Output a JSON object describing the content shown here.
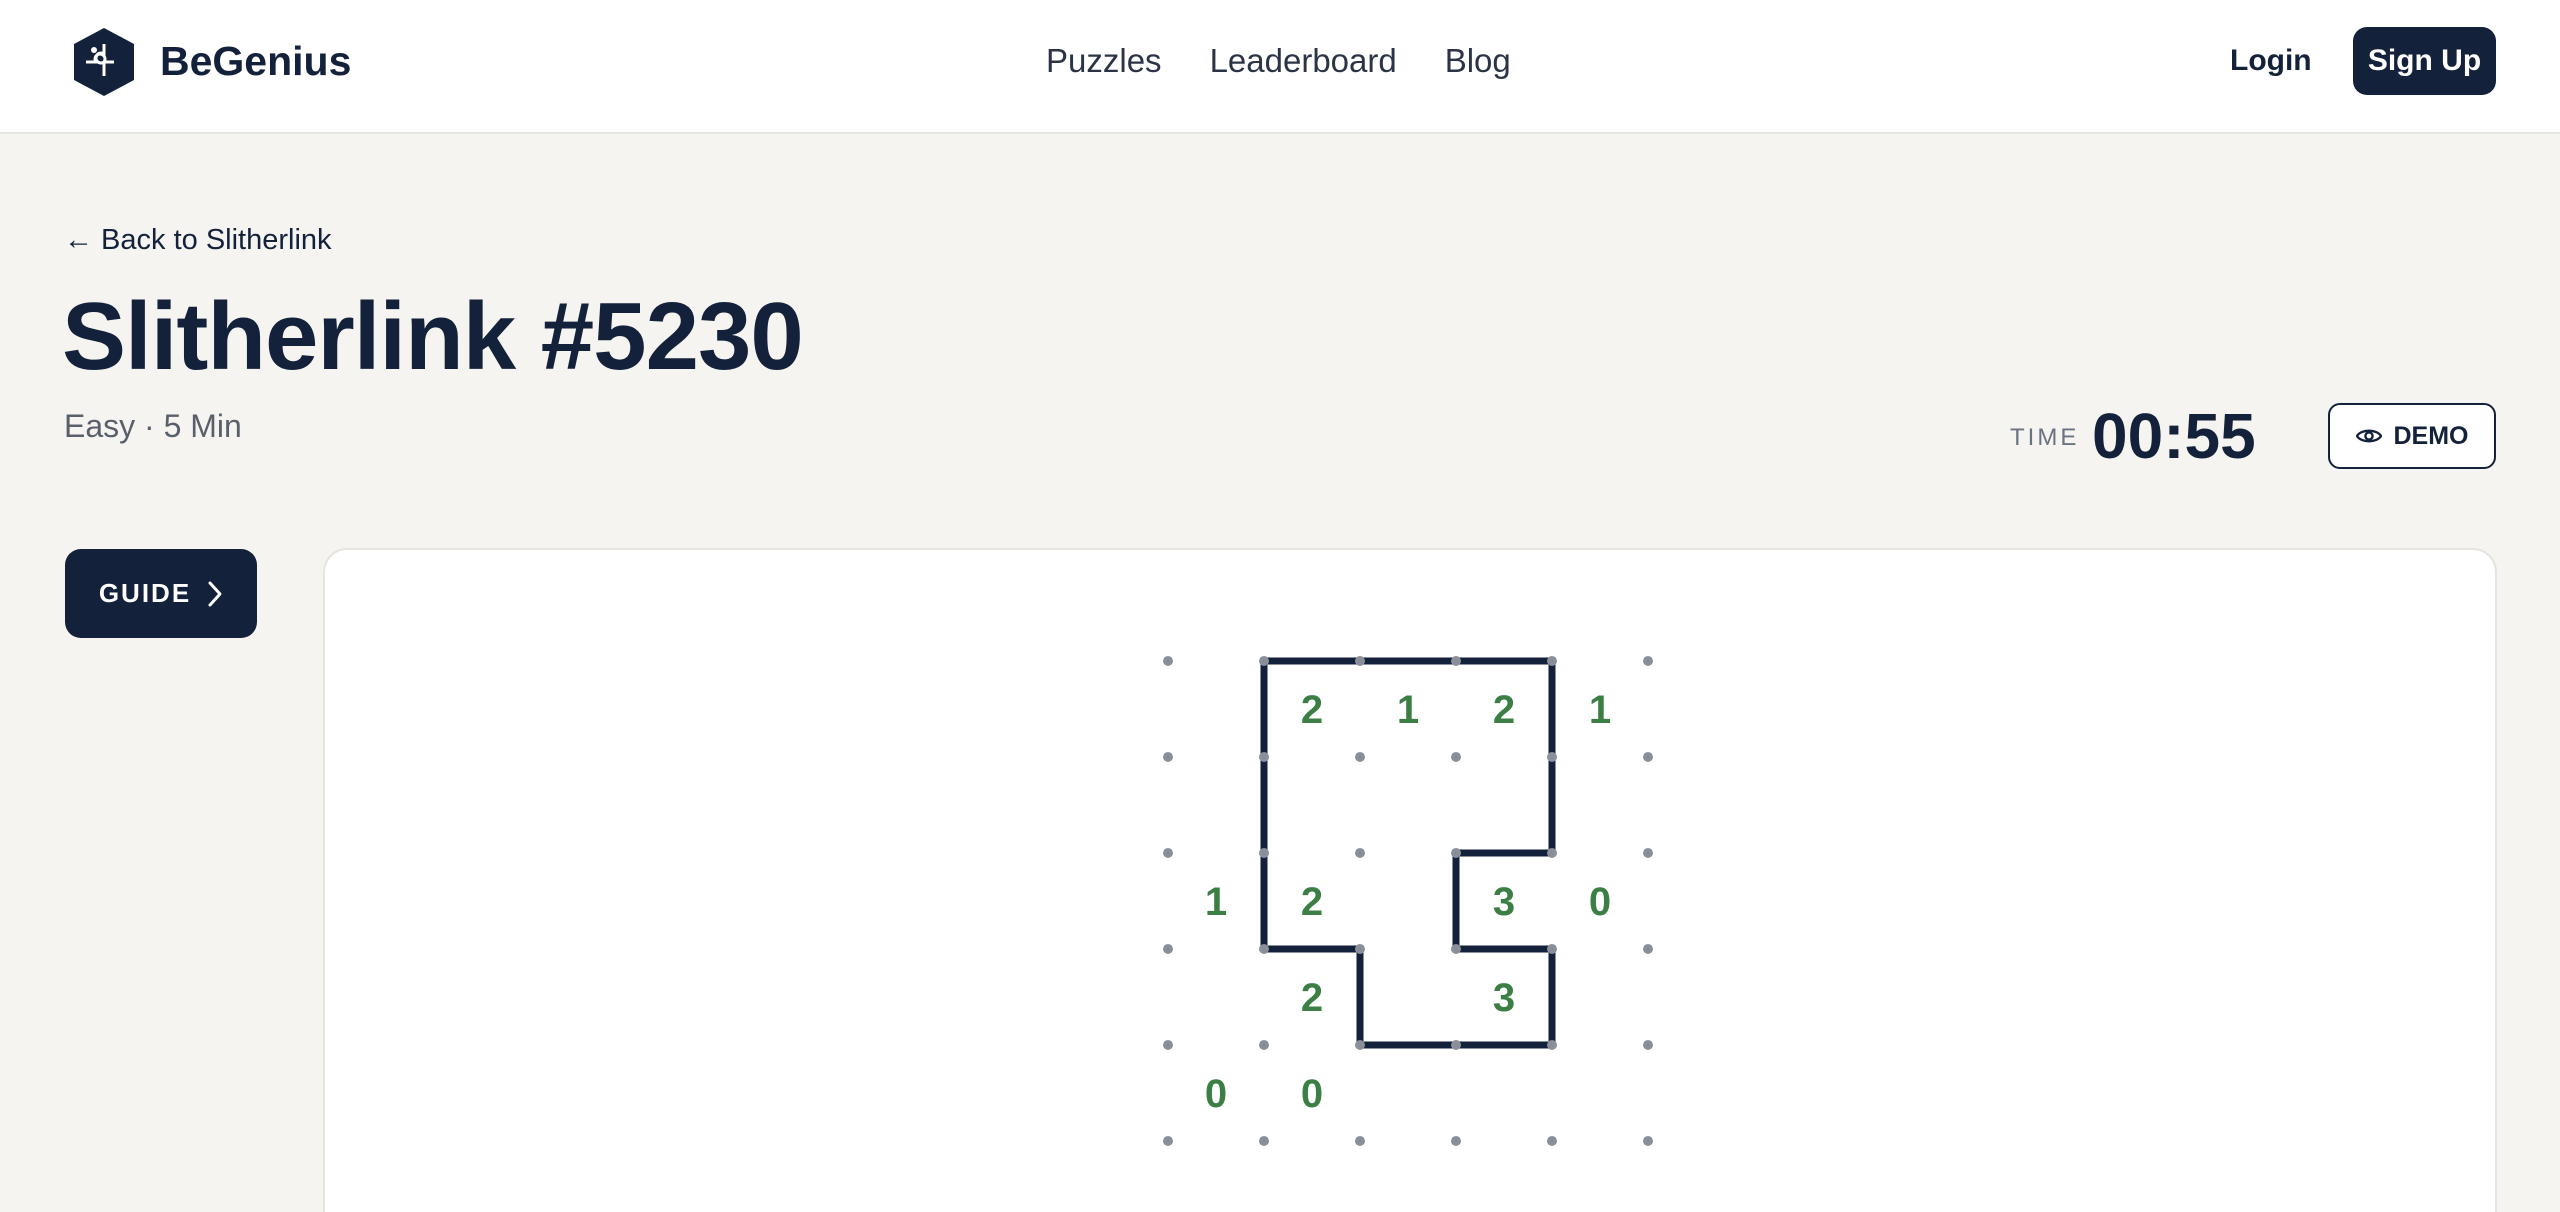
{
  "header": {
    "brand": "BeGenius",
    "logo_icon": "puzzle-hexagon-icon",
    "nav": [
      "Puzzles",
      "Leaderboard",
      "Blog"
    ],
    "login_label": "Login",
    "signup_label": "Sign Up"
  },
  "page": {
    "back_label": "← Back to Slitherlink",
    "title": "Slitherlink #5230",
    "subtitle": "Easy · 5 Min",
    "time_label": "TIME",
    "time_value": "00:55",
    "demo_label": "DEMO",
    "demo_icon": "eye-icon",
    "guide_label": "GUIDE",
    "guide_icon": "chevron-right-icon"
  },
  "colors": {
    "navy": "#13213a",
    "background": "#f5f4f0",
    "clue": "#3b7f45",
    "dot": "#8a8f9a"
  },
  "puzzle": {
    "rows": 5,
    "cols": 5,
    "clues": [
      [
        "",
        "2",
        "1",
        "2",
        "1"
      ],
      [
        "",
        "",
        "",
        "",
        ""
      ],
      [
        "1",
        "2",
        "",
        "3",
        "0"
      ],
      [
        "",
        "2",
        "",
        "3",
        ""
      ],
      [
        "0",
        "0",
        "",
        "",
        ""
      ]
    ],
    "edges": [
      [
        [
          1,
          0
        ],
        [
          4,
          0
        ]
      ],
      [
        [
          4,
          0
        ],
        [
          4,
          2
        ]
      ],
      [
        [
          4,
          2
        ],
        [
          3,
          2
        ]
      ],
      [
        [
          3,
          2
        ],
        [
          3,
          3
        ]
      ],
      [
        [
          3,
          3
        ],
        [
          4,
          3
        ]
      ],
      [
        [
          4,
          3
        ],
        [
          4,
          4
        ]
      ],
      [
        [
          4,
          4
        ],
        [
          2,
          4
        ]
      ],
      [
        [
          2,
          4
        ],
        [
          2,
          3
        ]
      ],
      [
        [
          2,
          3
        ],
        [
          1,
          3
        ]
      ],
      [
        [
          1,
          3
        ],
        [
          1,
          0
        ]
      ]
    ]
  }
}
